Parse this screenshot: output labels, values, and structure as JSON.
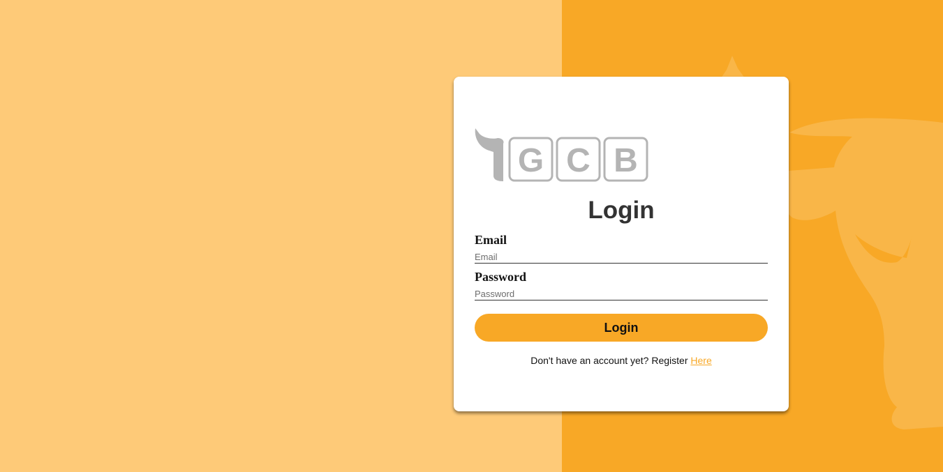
{
  "colors": {
    "left_background": "#FECA78",
    "right_background": "#F8A826",
    "accent": "#F8A826",
    "card": "#FFFFFF",
    "logo_gray": "#B4B4B4"
  },
  "logo": {
    "icon": "bull-head-icon",
    "text": "GCB",
    "letters": [
      "G",
      "C",
      "B"
    ]
  },
  "background": {
    "watermark_icon": "bull-watermark-icon"
  },
  "login_form": {
    "title": "Login",
    "email": {
      "label": "Email",
      "placeholder": "Email",
      "value": ""
    },
    "password": {
      "label": "Password",
      "placeholder": "Password",
      "value": ""
    },
    "submit_label": "Login",
    "register_prompt": "Don't have an account yet? Register",
    "register_link_text": "Here"
  }
}
